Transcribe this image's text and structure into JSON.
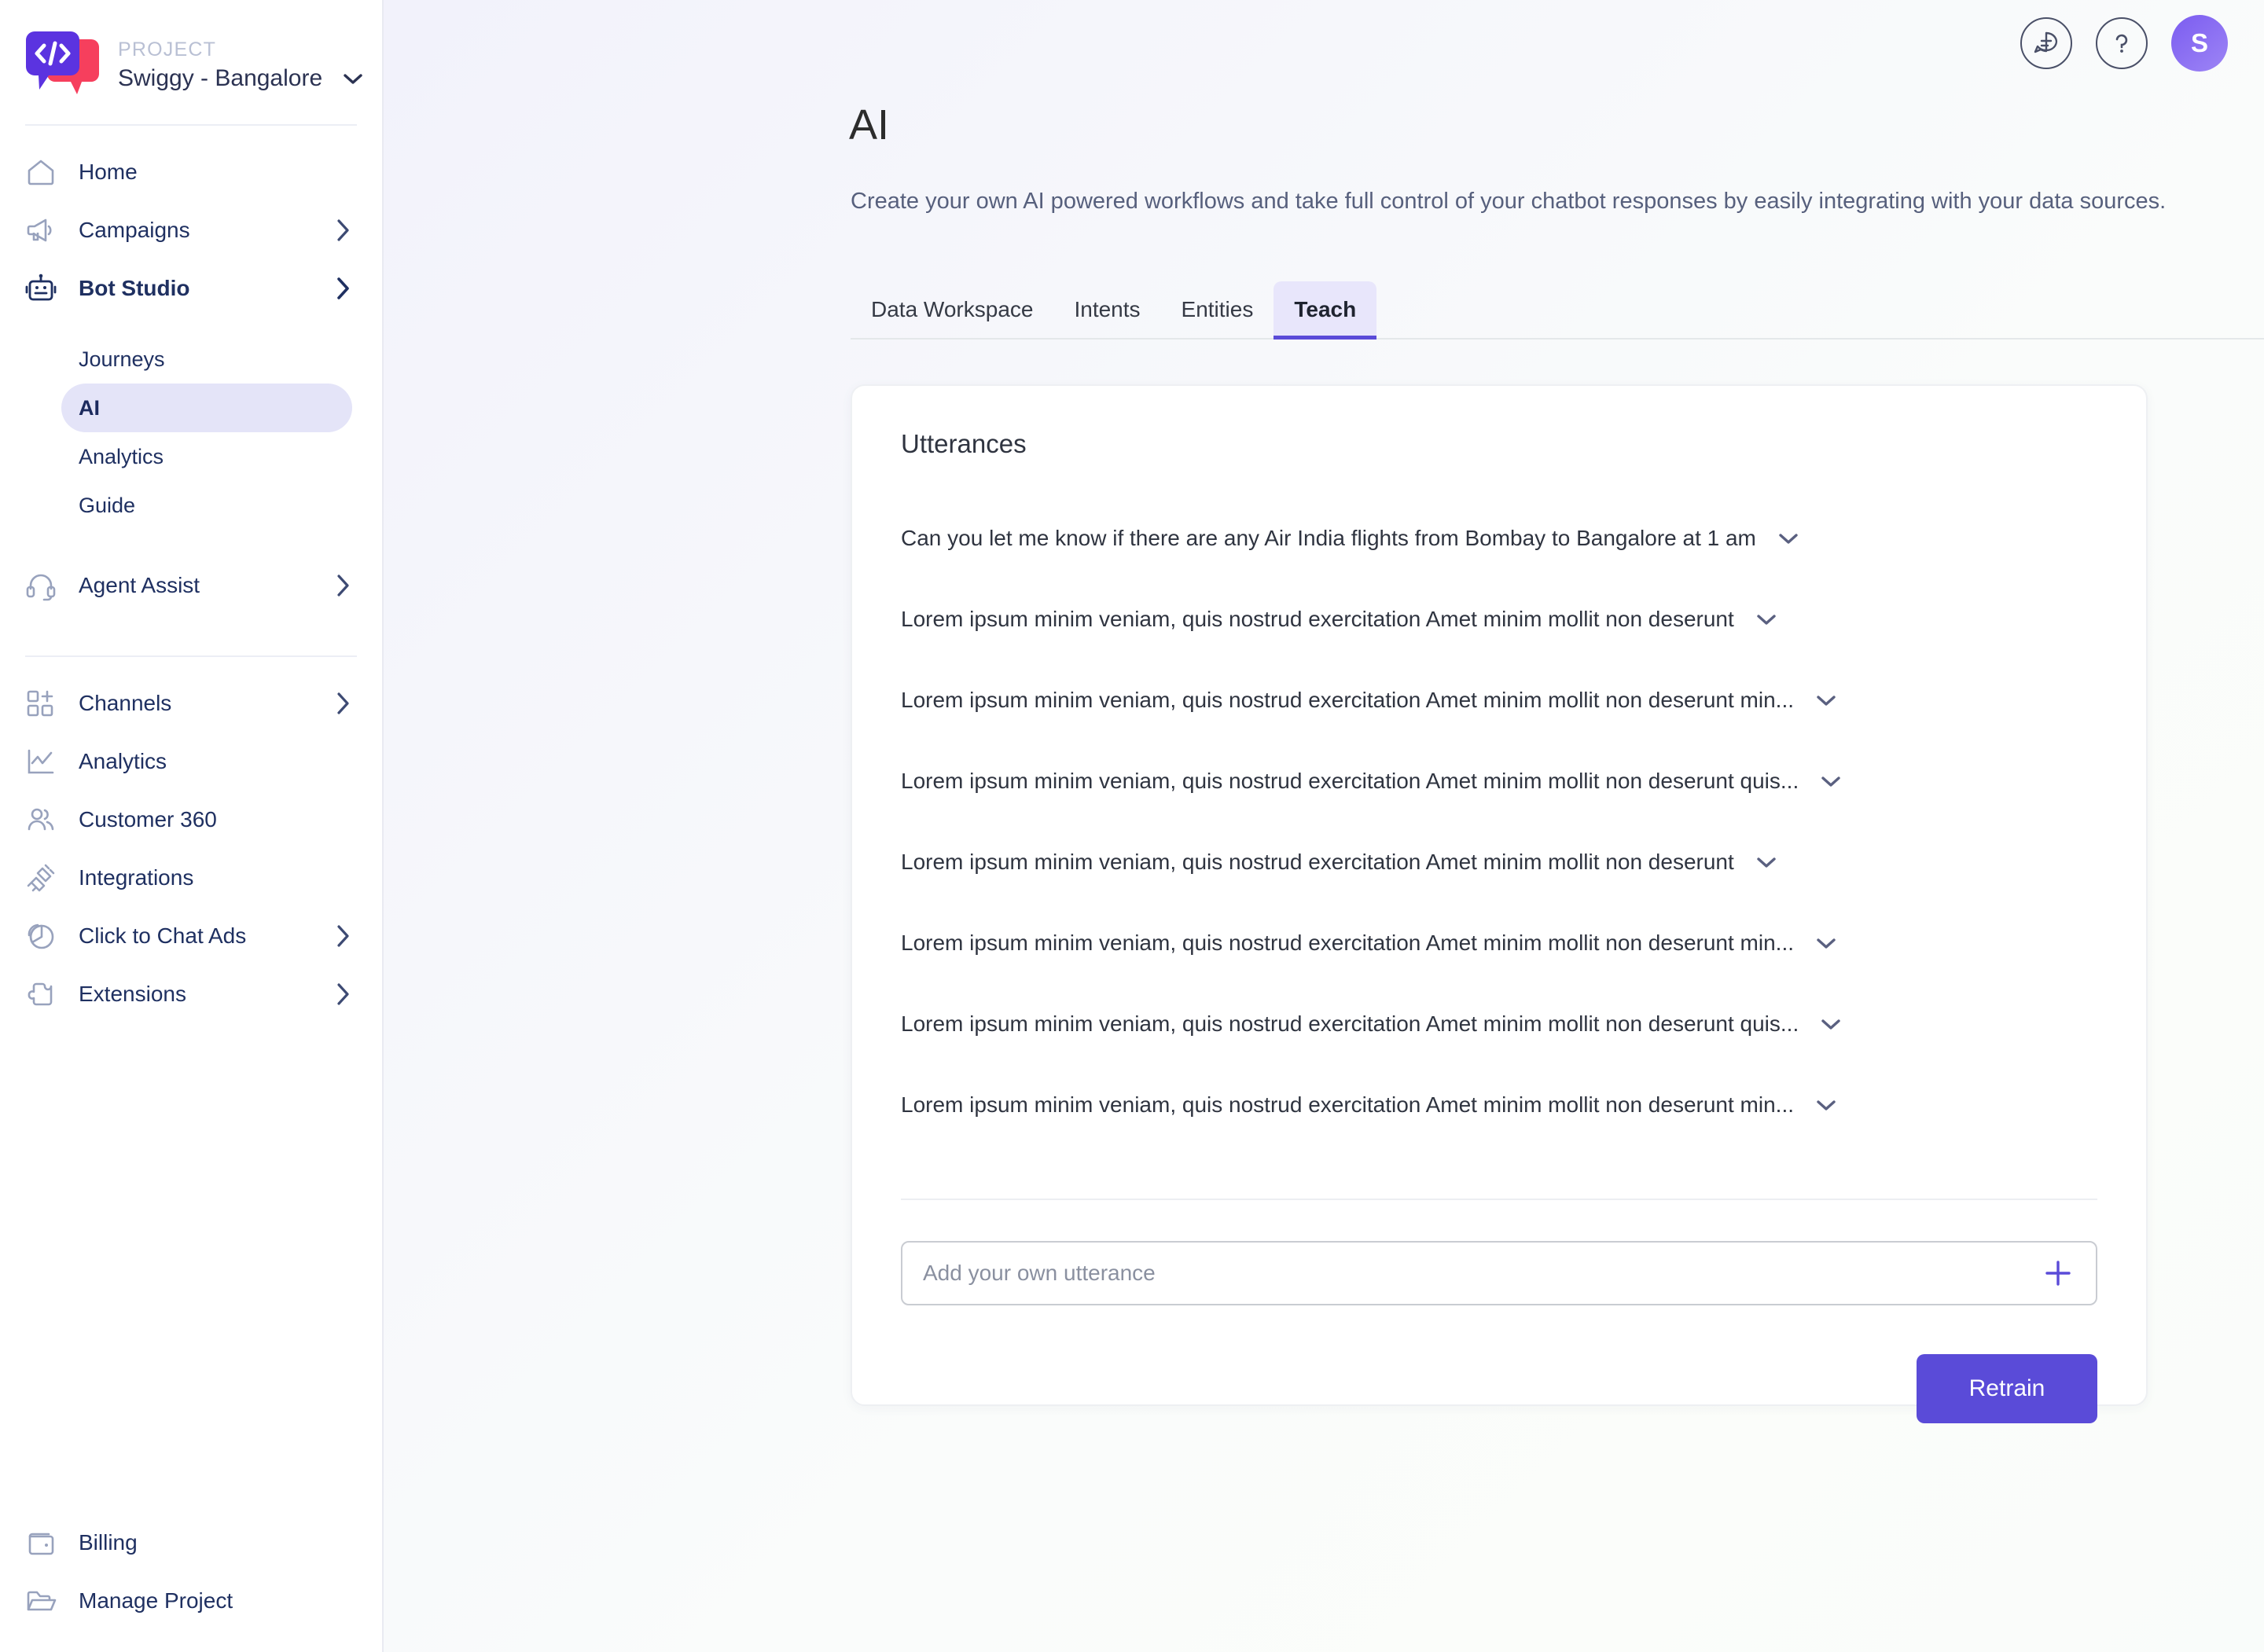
{
  "brand": {
    "kicker": "PROJECT",
    "project_name": "Swiggy - Bangalore",
    "logo_icon": "code-chat-bubble-logo",
    "caret_icon": "chevron-down-icon",
    "colors": {
      "primary": "#5a4bd8",
      "accent_red": "#f63f5d"
    }
  },
  "sidebar": {
    "items": [
      {
        "label": "Home",
        "icon": "home-icon",
        "has_chevron": false,
        "active": false
      },
      {
        "label": "Campaigns",
        "icon": "megaphone-icon",
        "has_chevron": true,
        "active": false
      },
      {
        "label": "Bot Studio",
        "icon": "robot-icon",
        "has_chevron": true,
        "active": true
      }
    ],
    "bot_studio_children": [
      {
        "label": "Journeys",
        "selected": false
      },
      {
        "label": "AI",
        "selected": true
      },
      {
        "label": "Analytics",
        "selected": false
      },
      {
        "label": "Guide",
        "selected": false
      }
    ],
    "group2": [
      {
        "label": "Agent Assist",
        "icon": "headset-icon",
        "has_chevron": true
      }
    ],
    "group3": [
      {
        "label": "Channels",
        "icon": "grid-plus-icon",
        "has_chevron": true
      },
      {
        "label": "Analytics",
        "icon": "line-chart-icon",
        "has_chevron": false
      },
      {
        "label": "Customer 360",
        "icon": "people-icon",
        "has_chevron": false
      },
      {
        "label": "Integrations",
        "icon": "plug-icon",
        "has_chevron": false
      },
      {
        "label": "Click to Chat Ads",
        "icon": "pie-chart-icon",
        "has_chevron": true
      },
      {
        "label": "Extensions",
        "icon": "puzzle-piece-icon",
        "has_chevron": true
      }
    ],
    "bottom": [
      {
        "label": "Billing",
        "icon": "wallet-icon",
        "has_chevron": false
      },
      {
        "label": "Manage Project",
        "icon": "folder-open-icon",
        "has_chevron": false
      }
    ]
  },
  "topbar": {
    "chat_icon": "chat-bubble-icon",
    "help_icon": "question-mark-icon",
    "avatar_initial": "S"
  },
  "page": {
    "title": "AI",
    "description": "Create your own AI powered workflows and take full control of your chatbot responses by easily integrating with your data sources."
  },
  "tabs": [
    {
      "label": "Data Workspace",
      "active": false
    },
    {
      "label": "Intents",
      "active": false
    },
    {
      "label": "Entities",
      "active": false
    },
    {
      "label": "Teach",
      "active": true
    }
  ],
  "utterances_card": {
    "title": "Utterances",
    "rows": [
      {
        "text": "Can you let me know if there are any Air India flights from Bombay to Bangalore at 1 am",
        "chevron_icon": "chevron-down-icon"
      },
      {
        "text": "Lorem ipsum minim veniam, quis nostrud exercitation Amet minim mollit non deserunt",
        "chevron_icon": "chevron-down-icon"
      },
      {
        "text": "Lorem ipsum minim veniam, quis nostrud exercitation Amet minim mollit non deserunt min...",
        "chevron_icon": "chevron-down-icon"
      },
      {
        "text": "Lorem ipsum minim veniam, quis nostrud exercitation Amet minim mollit non deserunt quis...",
        "chevron_icon": "chevron-down-icon"
      },
      {
        "text": "Lorem ipsum minim veniam, quis nostrud exercitation Amet minim mollit non deserunt",
        "chevron_icon": "chevron-down-icon"
      },
      {
        "text": "Lorem ipsum minim veniam, quis nostrud exercitation Amet minim mollit non deserunt min...",
        "chevron_icon": "chevron-down-icon"
      },
      {
        "text": "Lorem ipsum minim veniam, quis nostrud exercitation Amet minim mollit non deserunt quis...",
        "chevron_icon": "chevron-down-icon"
      },
      {
        "text": "Lorem ipsum minim veniam, quis nostrud exercitation Amet minim mollit non deserunt min...",
        "chevron_icon": "chevron-down-icon"
      }
    ],
    "input_placeholder": "Add your own utterance",
    "input_value": "",
    "add_icon": "plus-icon",
    "retrain_label": "Retrain"
  }
}
